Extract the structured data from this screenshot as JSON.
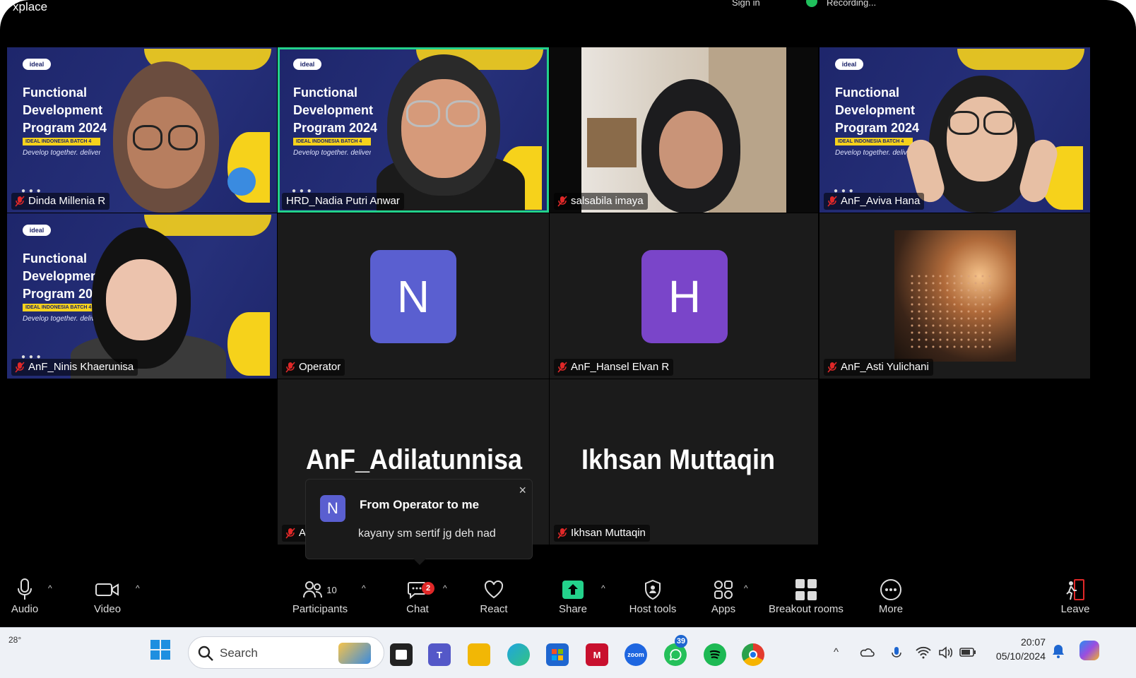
{
  "window": {
    "title_fragment": "xplace",
    "top_right_fragment_1": "Sign in",
    "top_right_fragment_2": "Recording..."
  },
  "banner": {
    "logo": "ideal",
    "title": "Functional\nDevelopment\nProgram 2024",
    "strip": "IDEAL INDONESIA BATCH 4",
    "tagline": "Develop together. deliver better"
  },
  "participants_grid": [
    {
      "name": "Dinda Millenia R",
      "type": "camera"
    },
    {
      "name": "HRD_Nadia Putri Anwar",
      "type": "camera",
      "active_speaker": true
    },
    {
      "name": "salsabila imaya",
      "type": "camera"
    },
    {
      "name": "AnF_Aviva Hana",
      "type": "camera"
    },
    {
      "name": "AnF_Ninis Khaerunisa",
      "type": "camera"
    },
    {
      "name": "Operator",
      "type": "avatar",
      "initial": "N",
      "color": "#5a5fd0"
    },
    {
      "name": "AnF_Hansel Elvan R",
      "type": "avatar",
      "initial": "H",
      "color": "#7a45c9"
    },
    {
      "name": "AnF_Asti Yulichani",
      "type": "photo"
    },
    {
      "name": "AnF_Adilatunnisa",
      "label_fragment": "A",
      "type": "name_only"
    },
    {
      "name": "Ikhsan Muttaqin",
      "type": "name_only"
    }
  ],
  "chat_notification": {
    "avatar_initial": "N",
    "title": "From Operator to me",
    "message": "kayany sm sertif jg deh nad",
    "close_icon": "×"
  },
  "toolbar": {
    "audio": "Audio",
    "video": "Video",
    "participants": "Participants",
    "participants_count": "10",
    "chat": "Chat",
    "chat_badge": "2",
    "react": "React",
    "share": "Share",
    "host_tools": "Host tools",
    "apps": "Apps",
    "breakout_rooms": "Breakout rooms",
    "more": "More",
    "leave": "Leave",
    "caret": "^"
  },
  "taskbar": {
    "weather": "28°",
    "search_placeholder": "Search",
    "whatsapp_badge": "39",
    "zoom_label": "zoom",
    "time": "20:07",
    "date": "05/10/2024"
  },
  "colors": {
    "active_speaker": "#23d18b",
    "share_green": "#23d18b",
    "banner_navy": "#21296b",
    "banner_yellow": "#f6d21b",
    "leave_red": "#e02828"
  }
}
